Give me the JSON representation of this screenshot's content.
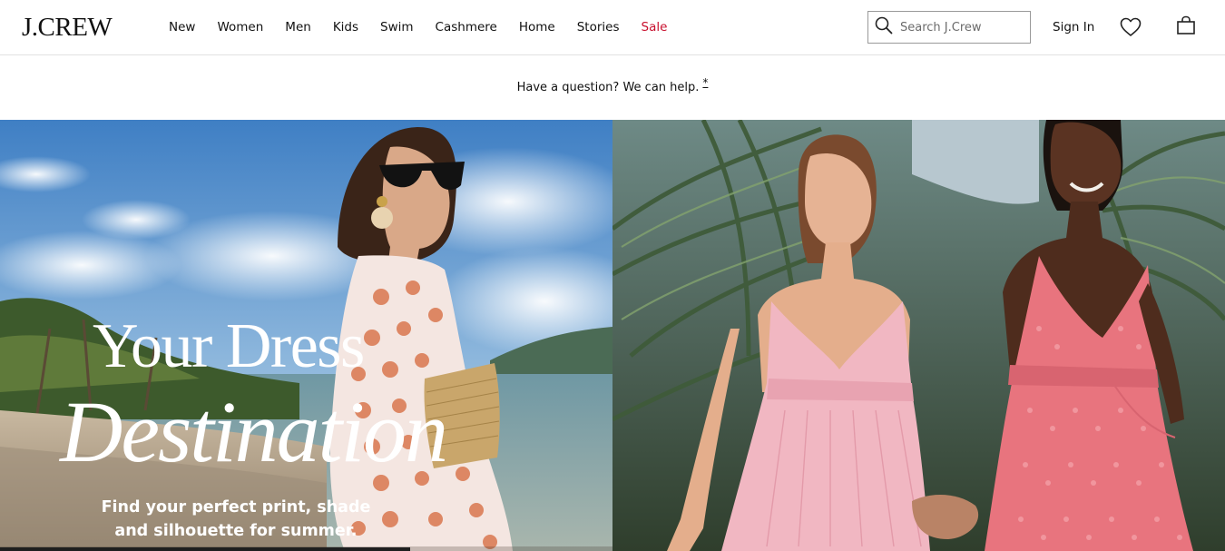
{
  "brand": {
    "logo": "J.CREW"
  },
  "nav": {
    "items": [
      {
        "label": "New"
      },
      {
        "label": "Women"
      },
      {
        "label": "Men"
      },
      {
        "label": "Kids"
      },
      {
        "label": "Swim"
      },
      {
        "label": "Cashmere"
      },
      {
        "label": "Home"
      },
      {
        "label": "Stories"
      },
      {
        "label": "Sale"
      }
    ]
  },
  "search": {
    "placeholder": "Search J.Crew",
    "value": "",
    "icon": "search-icon"
  },
  "account": {
    "sign_in": "Sign In",
    "wishlist_icon": "heart-icon",
    "bag_icon": "shopping-bag-icon"
  },
  "promo": {
    "text": "Have a question? We can help.",
    "footnote": "*"
  },
  "hero": {
    "title_line1": "Your Dress",
    "title_line2": "Destination",
    "subtitle": "Find your perfect print, shade and silhouette for summer."
  },
  "colors": {
    "sale": "#c8102e",
    "text": "#111111",
    "border": "#e2e2e2"
  }
}
